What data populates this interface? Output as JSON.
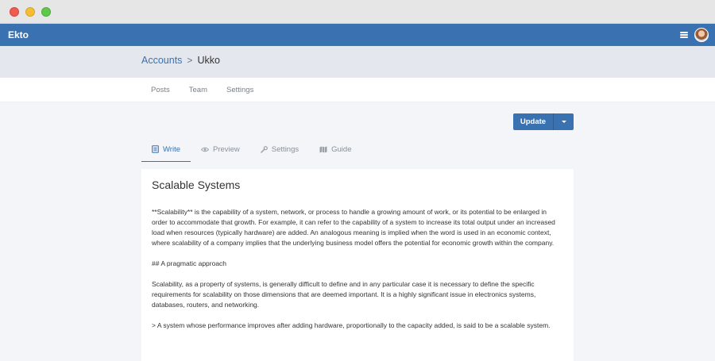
{
  "window": {
    "controls": [
      "close",
      "minimize",
      "zoom"
    ]
  },
  "appbar": {
    "brand": "Ekto",
    "menu_icon": "hamburger-menu-icon",
    "avatar": "user-avatar"
  },
  "breadcrumb": {
    "parent": "Accounts",
    "separator": ">",
    "current": "Ukko"
  },
  "subnav": {
    "items": [
      "Posts",
      "Team",
      "Settings"
    ]
  },
  "toolbar": {
    "update_label": "Update"
  },
  "editor_tabs": [
    {
      "label": "Write",
      "icon": "document-icon",
      "active": true
    },
    {
      "label": "Preview",
      "icon": "eye-icon",
      "active": false
    },
    {
      "label": "Settings",
      "icon": "wrench-icon",
      "active": false
    },
    {
      "label": "Guide",
      "icon": "map-icon",
      "active": false
    }
  ],
  "document": {
    "title": "Scalable Systems",
    "paragraphs": [
      "**Scalability** is the capability of a system, network, or process to handle a growing amount of work, or its potential to be enlarged in order to accommodate that growth. For example, it can refer to the capability of a system to increase its total output under an increased load when resources (typically hardware) are added. An analogous meaning is implied when the word is used in an economic context, where scalability of a company implies that the underlying business model offers the potential for economic growth within the company.",
      "## A pragmatic approach",
      "Scalability, as a property of systems, is generally difficult to define and in any particular case it is necessary to define the specific requirements for scalability on those dimensions that are deemed important. It is a highly significant issue in electronics systems, databases, routers, and networking.",
      "> A system whose performance improves after adding hardware, proportionally to the capacity added, is said to be a scalable system."
    ]
  },
  "colors": {
    "primary": "#3a71b1",
    "header_band": "#e4e8ee",
    "background": "#f3f5f8"
  }
}
